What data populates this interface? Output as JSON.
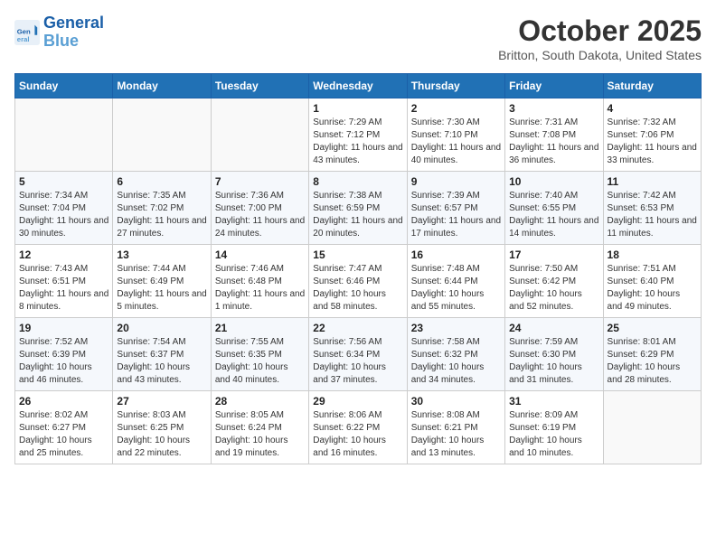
{
  "header": {
    "logo_line1": "General",
    "logo_line2": "Blue",
    "month": "October 2025",
    "location": "Britton, South Dakota, United States"
  },
  "days_of_week": [
    "Sunday",
    "Monday",
    "Tuesday",
    "Wednesday",
    "Thursday",
    "Friday",
    "Saturday"
  ],
  "weeks": [
    [
      {
        "day": "",
        "info": ""
      },
      {
        "day": "",
        "info": ""
      },
      {
        "day": "",
        "info": ""
      },
      {
        "day": "1",
        "info": "Sunrise: 7:29 AM\nSunset: 7:12 PM\nDaylight: 11 hours and 43 minutes."
      },
      {
        "day": "2",
        "info": "Sunrise: 7:30 AM\nSunset: 7:10 PM\nDaylight: 11 hours and 40 minutes."
      },
      {
        "day": "3",
        "info": "Sunrise: 7:31 AM\nSunset: 7:08 PM\nDaylight: 11 hours and 36 minutes."
      },
      {
        "day": "4",
        "info": "Sunrise: 7:32 AM\nSunset: 7:06 PM\nDaylight: 11 hours and 33 minutes."
      }
    ],
    [
      {
        "day": "5",
        "info": "Sunrise: 7:34 AM\nSunset: 7:04 PM\nDaylight: 11 hours and 30 minutes."
      },
      {
        "day": "6",
        "info": "Sunrise: 7:35 AM\nSunset: 7:02 PM\nDaylight: 11 hours and 27 minutes."
      },
      {
        "day": "7",
        "info": "Sunrise: 7:36 AM\nSunset: 7:00 PM\nDaylight: 11 hours and 24 minutes."
      },
      {
        "day": "8",
        "info": "Sunrise: 7:38 AM\nSunset: 6:59 PM\nDaylight: 11 hours and 20 minutes."
      },
      {
        "day": "9",
        "info": "Sunrise: 7:39 AM\nSunset: 6:57 PM\nDaylight: 11 hours and 17 minutes."
      },
      {
        "day": "10",
        "info": "Sunrise: 7:40 AM\nSunset: 6:55 PM\nDaylight: 11 hours and 14 minutes."
      },
      {
        "day": "11",
        "info": "Sunrise: 7:42 AM\nSunset: 6:53 PM\nDaylight: 11 hours and 11 minutes."
      }
    ],
    [
      {
        "day": "12",
        "info": "Sunrise: 7:43 AM\nSunset: 6:51 PM\nDaylight: 11 hours and 8 minutes."
      },
      {
        "day": "13",
        "info": "Sunrise: 7:44 AM\nSunset: 6:49 PM\nDaylight: 11 hours and 5 minutes."
      },
      {
        "day": "14",
        "info": "Sunrise: 7:46 AM\nSunset: 6:48 PM\nDaylight: 11 hours and 1 minute."
      },
      {
        "day": "15",
        "info": "Sunrise: 7:47 AM\nSunset: 6:46 PM\nDaylight: 10 hours and 58 minutes."
      },
      {
        "day": "16",
        "info": "Sunrise: 7:48 AM\nSunset: 6:44 PM\nDaylight: 10 hours and 55 minutes."
      },
      {
        "day": "17",
        "info": "Sunrise: 7:50 AM\nSunset: 6:42 PM\nDaylight: 10 hours and 52 minutes."
      },
      {
        "day": "18",
        "info": "Sunrise: 7:51 AM\nSunset: 6:40 PM\nDaylight: 10 hours and 49 minutes."
      }
    ],
    [
      {
        "day": "19",
        "info": "Sunrise: 7:52 AM\nSunset: 6:39 PM\nDaylight: 10 hours and 46 minutes."
      },
      {
        "day": "20",
        "info": "Sunrise: 7:54 AM\nSunset: 6:37 PM\nDaylight: 10 hours and 43 minutes."
      },
      {
        "day": "21",
        "info": "Sunrise: 7:55 AM\nSunset: 6:35 PM\nDaylight: 10 hours and 40 minutes."
      },
      {
        "day": "22",
        "info": "Sunrise: 7:56 AM\nSunset: 6:34 PM\nDaylight: 10 hours and 37 minutes."
      },
      {
        "day": "23",
        "info": "Sunrise: 7:58 AM\nSunset: 6:32 PM\nDaylight: 10 hours and 34 minutes."
      },
      {
        "day": "24",
        "info": "Sunrise: 7:59 AM\nSunset: 6:30 PM\nDaylight: 10 hours and 31 minutes."
      },
      {
        "day": "25",
        "info": "Sunrise: 8:01 AM\nSunset: 6:29 PM\nDaylight: 10 hours and 28 minutes."
      }
    ],
    [
      {
        "day": "26",
        "info": "Sunrise: 8:02 AM\nSunset: 6:27 PM\nDaylight: 10 hours and 25 minutes."
      },
      {
        "day": "27",
        "info": "Sunrise: 8:03 AM\nSunset: 6:25 PM\nDaylight: 10 hours and 22 minutes."
      },
      {
        "day": "28",
        "info": "Sunrise: 8:05 AM\nSunset: 6:24 PM\nDaylight: 10 hours and 19 minutes."
      },
      {
        "day": "29",
        "info": "Sunrise: 8:06 AM\nSunset: 6:22 PM\nDaylight: 10 hours and 16 minutes."
      },
      {
        "day": "30",
        "info": "Sunrise: 8:08 AM\nSunset: 6:21 PM\nDaylight: 10 hours and 13 minutes."
      },
      {
        "day": "31",
        "info": "Sunrise: 8:09 AM\nSunset: 6:19 PM\nDaylight: 10 hours and 10 minutes."
      },
      {
        "day": "",
        "info": ""
      }
    ]
  ]
}
